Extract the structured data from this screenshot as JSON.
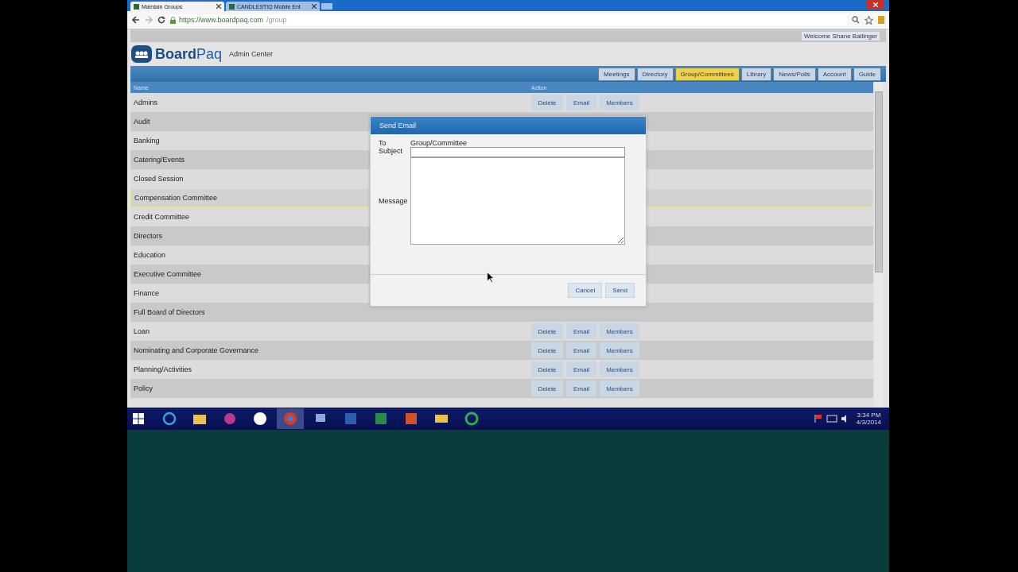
{
  "browser": {
    "tabs": [
      {
        "title": "Maintain Groups",
        "selected": true
      },
      {
        "title": "CANDLESTIQ Mobile Ent",
        "selected": false
      }
    ],
    "url": {
      "host": "https://www.boardpaq.com",
      "path": "/group"
    }
  },
  "user": "Welcome Shane Ballinger",
  "logo": {
    "brand_a": "Board",
    "brand_b": "Paq",
    "subtitle": "Admin Center"
  },
  "nav": [
    {
      "label": "Meetings",
      "selected": false
    },
    {
      "label": "Directory",
      "selected": false
    },
    {
      "label": "Group/Committees",
      "selected": true
    },
    {
      "label": "Library",
      "selected": false
    },
    {
      "label": "News/Polls",
      "selected": false
    },
    {
      "label": "Account",
      "selected": false
    },
    {
      "label": "Guide",
      "selected": false
    }
  ],
  "table": {
    "columns": [
      "Name",
      "Action"
    ],
    "rows": [
      {
        "name": "Admins",
        "selected": false,
        "actions": [
          "Delete",
          "Email",
          "Members"
        ]
      },
      {
        "name": "Audit",
        "selected": false
      },
      {
        "name": "Banking",
        "selected": false
      },
      {
        "name": "Catering/Events",
        "selected": false
      },
      {
        "name": "Closed Session",
        "selected": false
      },
      {
        "name": "Compensation Committee",
        "selected": true
      },
      {
        "name": "Credit Committee",
        "selected": false
      },
      {
        "name": "Directors",
        "selected": false
      },
      {
        "name": "Education",
        "selected": false
      },
      {
        "name": "Executive Committee",
        "selected": false
      },
      {
        "name": "Finance",
        "selected": false
      },
      {
        "name": "Full Board of Directors",
        "selected": false
      },
      {
        "name": "Loan",
        "selected": false,
        "actions": [
          "Delete",
          "Email",
          "Members"
        ]
      },
      {
        "name": "Nominating and Corporate Governance",
        "selected": false,
        "actions": [
          "Delete",
          "Email",
          "Members"
        ]
      },
      {
        "name": "Planning/Activities",
        "selected": false,
        "actions": [
          "Delete",
          "Email",
          "Members"
        ]
      },
      {
        "name": "Policy",
        "selected": false,
        "actions": [
          "Delete",
          "Email",
          "Members"
        ]
      }
    ]
  },
  "dialog": {
    "title": "Send Email",
    "to_label": "To",
    "to_value": "Group/Committee",
    "subject_label": "Subject",
    "message_label": "Message",
    "buttons": [
      "Cancel",
      "Send"
    ]
  },
  "clock": {
    "time": "3:34 PM",
    "date": "4/3/2014"
  }
}
